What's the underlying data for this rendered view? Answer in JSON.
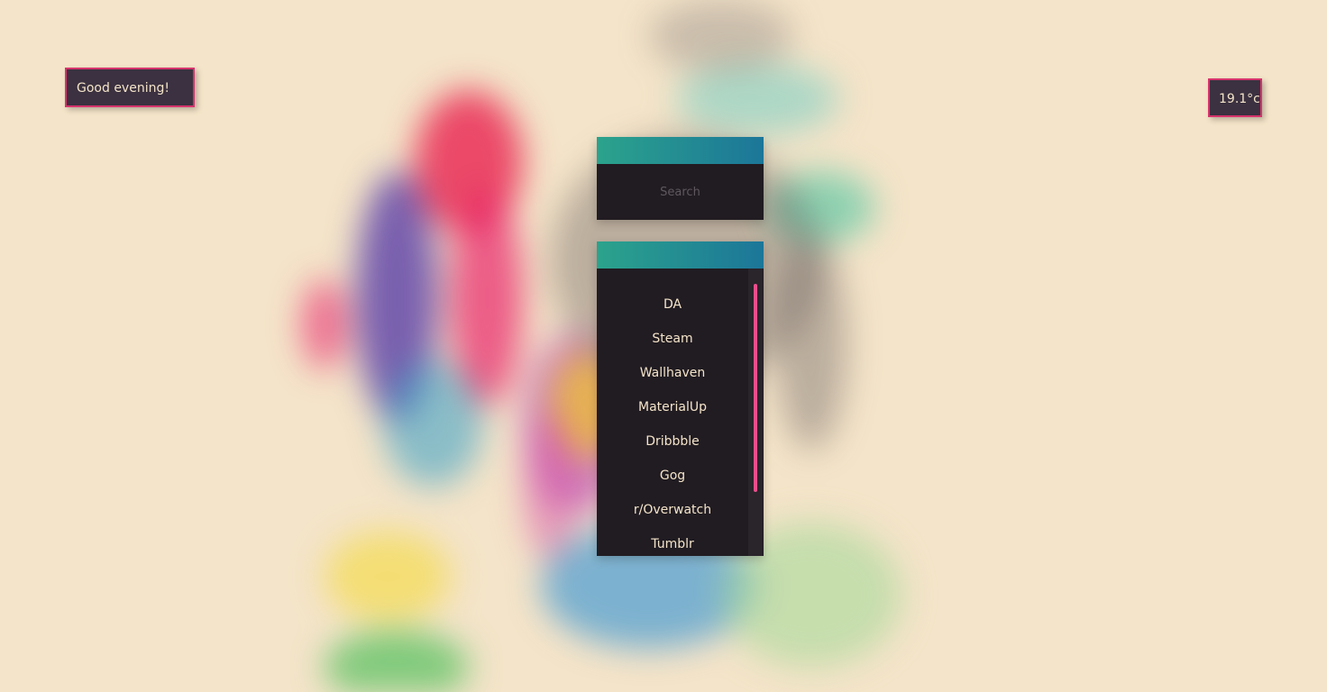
{
  "greeting": {
    "text": "Good evening!"
  },
  "weather": {
    "temperature": "19.1°c"
  },
  "search": {
    "placeholder": "Search"
  },
  "links": {
    "items": [
      {
        "label": "DA"
      },
      {
        "label": "Steam"
      },
      {
        "label": "Wallhaven"
      },
      {
        "label": "MaterialUp"
      },
      {
        "label": "Dribbble"
      },
      {
        "label": "Gog"
      },
      {
        "label": "r/Overwatch"
      },
      {
        "label": "Tumblr"
      }
    ]
  },
  "colors": {
    "background": "#f4e4c9",
    "panel": "#211c22",
    "chip": "#3b3140",
    "chip_border": "#d6336c",
    "header_gradient_start": "#2ba38c",
    "header_gradient_end": "#1c7699",
    "scroll_thumb": "#e84f8c",
    "text": "#f4e4c9"
  }
}
